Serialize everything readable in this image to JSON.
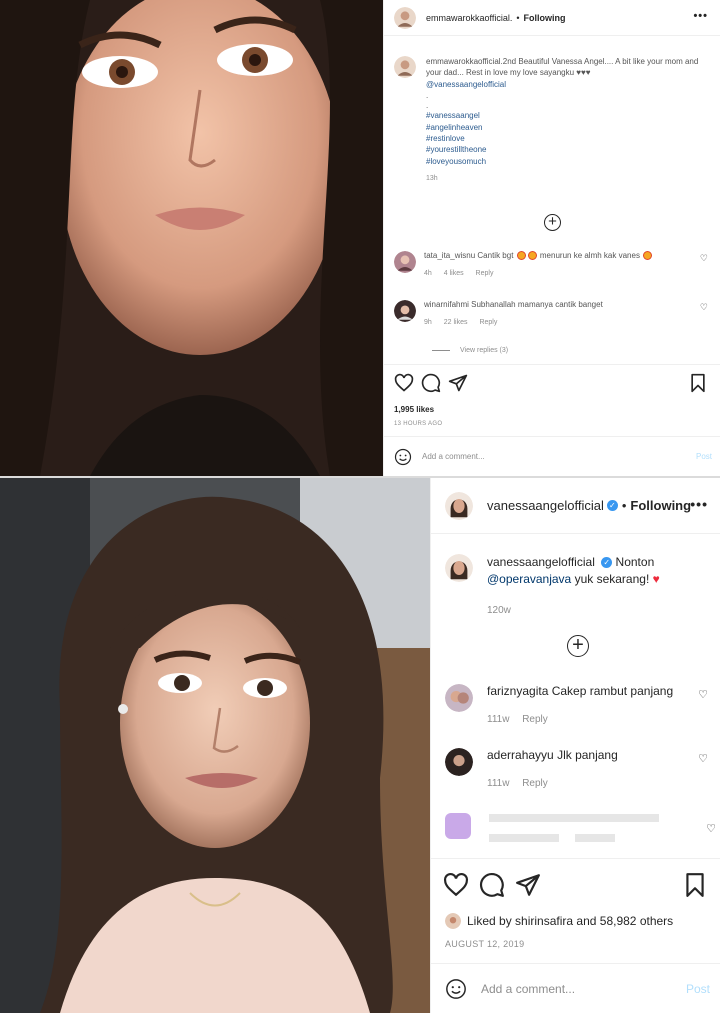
{
  "post1": {
    "username": "emmawarokkaofficial.",
    "dot": "•",
    "follow_label": "Following",
    "more_label": "•••",
    "caption": {
      "username": "emmawarokkaofficial.",
      "text": "2nd Beautiful Vanessa Angel.... A bit like your mom and your dad... Rest in love my love sayangku ♥♥♥",
      "mention": "@vanessaangelofficial",
      "dots": [
        ".",
        "."
      ],
      "hashtags": [
        "#vanessaangel",
        "#angelinheaven",
        "#restinlove",
        "#yourestilltheone",
        "#loveyousomuch"
      ],
      "time": "13h"
    },
    "comments": [
      {
        "username": "tata_ita_wisnu",
        "text_a": "Cantik bgt",
        "text_b": "menurun ke almh kak vanes",
        "time": "4h",
        "likes": "4 likes",
        "reply": "Reply"
      },
      {
        "username": "winarnifahmi",
        "text": "Subhanallah mamanya cantik banget",
        "time": "9h",
        "likes": "22 likes",
        "reply": "Reply"
      }
    ],
    "view_replies": "View replies (3)",
    "likes": "1,995 likes",
    "date": "13 HOURS AGO",
    "add_comment_placeholder": "Add a comment...",
    "post_button": "Post"
  },
  "post2": {
    "username": "vanessaangelofficial",
    "verified": "✓",
    "dot": "•",
    "follow_label": "Following",
    "more_label": "•••",
    "caption": {
      "username": "vanessaangelofficial",
      "text": "Nonton",
      "mention": "@operavanjava",
      "text_after": "yuk sekarang!",
      "time": "120w"
    },
    "comments": [
      {
        "username": "fariznyagita",
        "text": "Cakep rambut panjang",
        "time": "111w",
        "reply": "Reply"
      },
      {
        "username": "aderrahayyu",
        "text": "Jlk panjang",
        "time": "111w",
        "reply": "Reply"
      }
    ],
    "liked_by_prefix": "Liked by",
    "liked_by_user": "shirinsafira",
    "liked_by_suffix": "and 58,982 others",
    "date": "AUGUST 12, 2019",
    "add_comment_placeholder": "Add a comment...",
    "post_button": "Post"
  },
  "icons": {
    "like": "heart-outline-icon",
    "comment": "comment-bubble-icon",
    "share": "paper-plane-icon",
    "save": "bookmark-icon",
    "emoji": "smiley-icon",
    "load_more": "plus-circle-icon",
    "verified": "verified-badge-icon"
  },
  "colors": {
    "link": "#00376b",
    "verified": "#3897f0",
    "post_button_disabled": "#b2dffc",
    "muted": "#8e8e8e",
    "heart_red": "#ed2b3c"
  }
}
